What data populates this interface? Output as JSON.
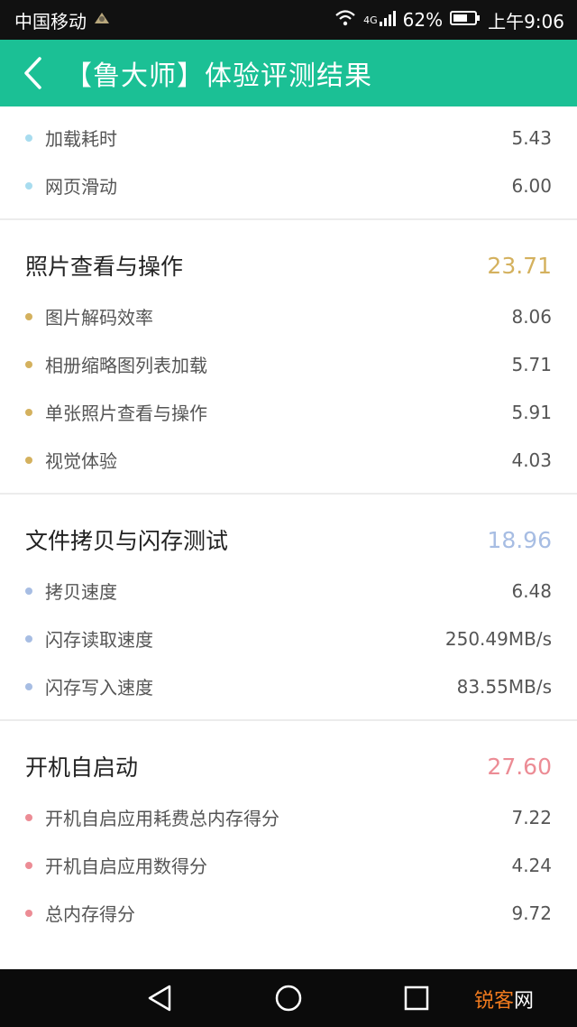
{
  "status_bar": {
    "carrier": "中国移动",
    "network": "4G",
    "battery": "62%",
    "time": "上午9:06"
  },
  "app_bar": {
    "title": "【鲁大师】体验评测结果"
  },
  "colors": {
    "app_bar": "#1bc095",
    "blue": "#a8dcef",
    "gold": "#d4b15e",
    "periwinkle": "#a7bde3",
    "pink": "#ec8c95"
  },
  "partial_section": {
    "items": [
      {
        "label": "加载耗时",
        "value": "5.43"
      },
      {
        "label": "网页滑动",
        "value": "6.00"
      }
    ]
  },
  "sections": [
    {
      "title": "照片查看与操作",
      "score": "23.71",
      "color": "#d4b15e",
      "items": [
        {
          "label": "图片解码效率",
          "value": "8.06"
        },
        {
          "label": "相册缩略图列表加载",
          "value": "5.71"
        },
        {
          "label": "单张照片查看与操作",
          "value": "5.91"
        },
        {
          "label": "视觉体验",
          "value": "4.03"
        }
      ]
    },
    {
      "title": "文件拷贝与闪存测试",
      "score": "18.96",
      "color": "#a7bde3",
      "items": [
        {
          "label": "拷贝速度",
          "value": "6.48"
        },
        {
          "label": "闪存读取速度",
          "value": "250.49MB/s"
        },
        {
          "label": "闪存写入速度",
          "value": "83.55MB/s"
        }
      ]
    },
    {
      "title": "开机自启动",
      "score": "27.60",
      "color": "#ec8c95",
      "items": [
        {
          "label": "开机自启应用耗费总内存得分",
          "value": "7.22"
        },
        {
          "label": "开机自启应用数得分",
          "value": "4.24"
        },
        {
          "label": "总内存得分",
          "value": "9.72"
        }
      ]
    }
  ],
  "watermark": {
    "part1": "锐客",
    "part2": "网"
  }
}
